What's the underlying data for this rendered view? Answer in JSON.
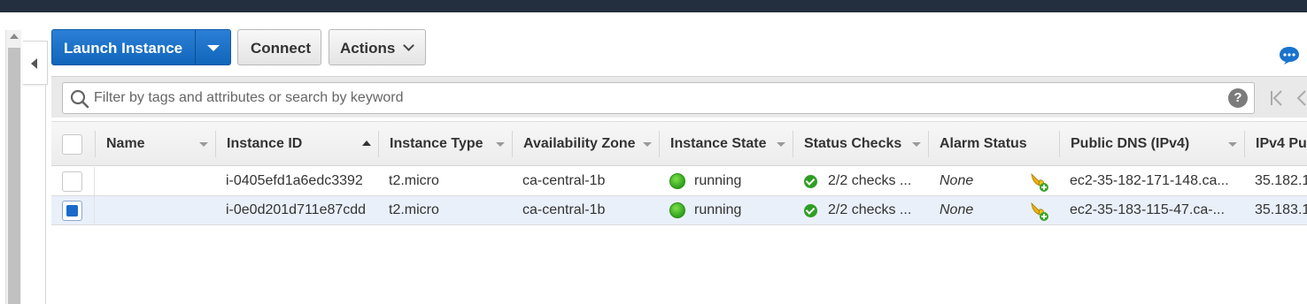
{
  "toolbar": {
    "launch_label": "Launch Instance",
    "connect_label": "Connect",
    "actions_label": "Actions"
  },
  "search": {
    "placeholder": "Filter by tags and attributes or search by keyword",
    "value": "",
    "help_label": "?"
  },
  "table": {
    "columns": [
      "Name",
      "Instance ID",
      "Instance Type",
      "Availability Zone",
      "Instance State",
      "Status Checks",
      "Alarm Status",
      "Public DNS (IPv4)",
      "IPv4 Pu"
    ],
    "sorted_column": "Instance ID",
    "rows": [
      {
        "selected": false,
        "name": "",
        "instance_id": "i-0405efd1a6edc3392",
        "instance_type": "t2.micro",
        "availability_zone": "ca-central-1b",
        "instance_state": "running",
        "status_checks": "2/2 checks ...",
        "alarm_status": "None",
        "public_dns": "ec2-35-182-171-148.ca...",
        "ipv4_public": "35.182.1"
      },
      {
        "selected": true,
        "name": "",
        "instance_id": "i-0e0d201d711e87cdd",
        "instance_type": "t2.micro",
        "availability_zone": "ca-central-1b",
        "instance_state": "running",
        "status_checks": "2/2 checks ...",
        "alarm_status": "None",
        "public_dns": "ec2-35-183-115-47.ca-...",
        "ipv4_public": "35.183.1"
      }
    ]
  },
  "colors": {
    "header_bar": "#232f3e",
    "primary_button": "#1a73cc",
    "selected_row": "#e9f0fa",
    "running": "#3cb91f",
    "status_ok": "#2f9e24"
  },
  "icons": [
    "chevron-down-icon",
    "chat-icon",
    "search-icon",
    "help-icon",
    "first-page-icon",
    "prev-page-icon",
    "running-status-icon",
    "check-ok-icon",
    "alarm-add-icon",
    "collapse-panel-icon"
  ]
}
